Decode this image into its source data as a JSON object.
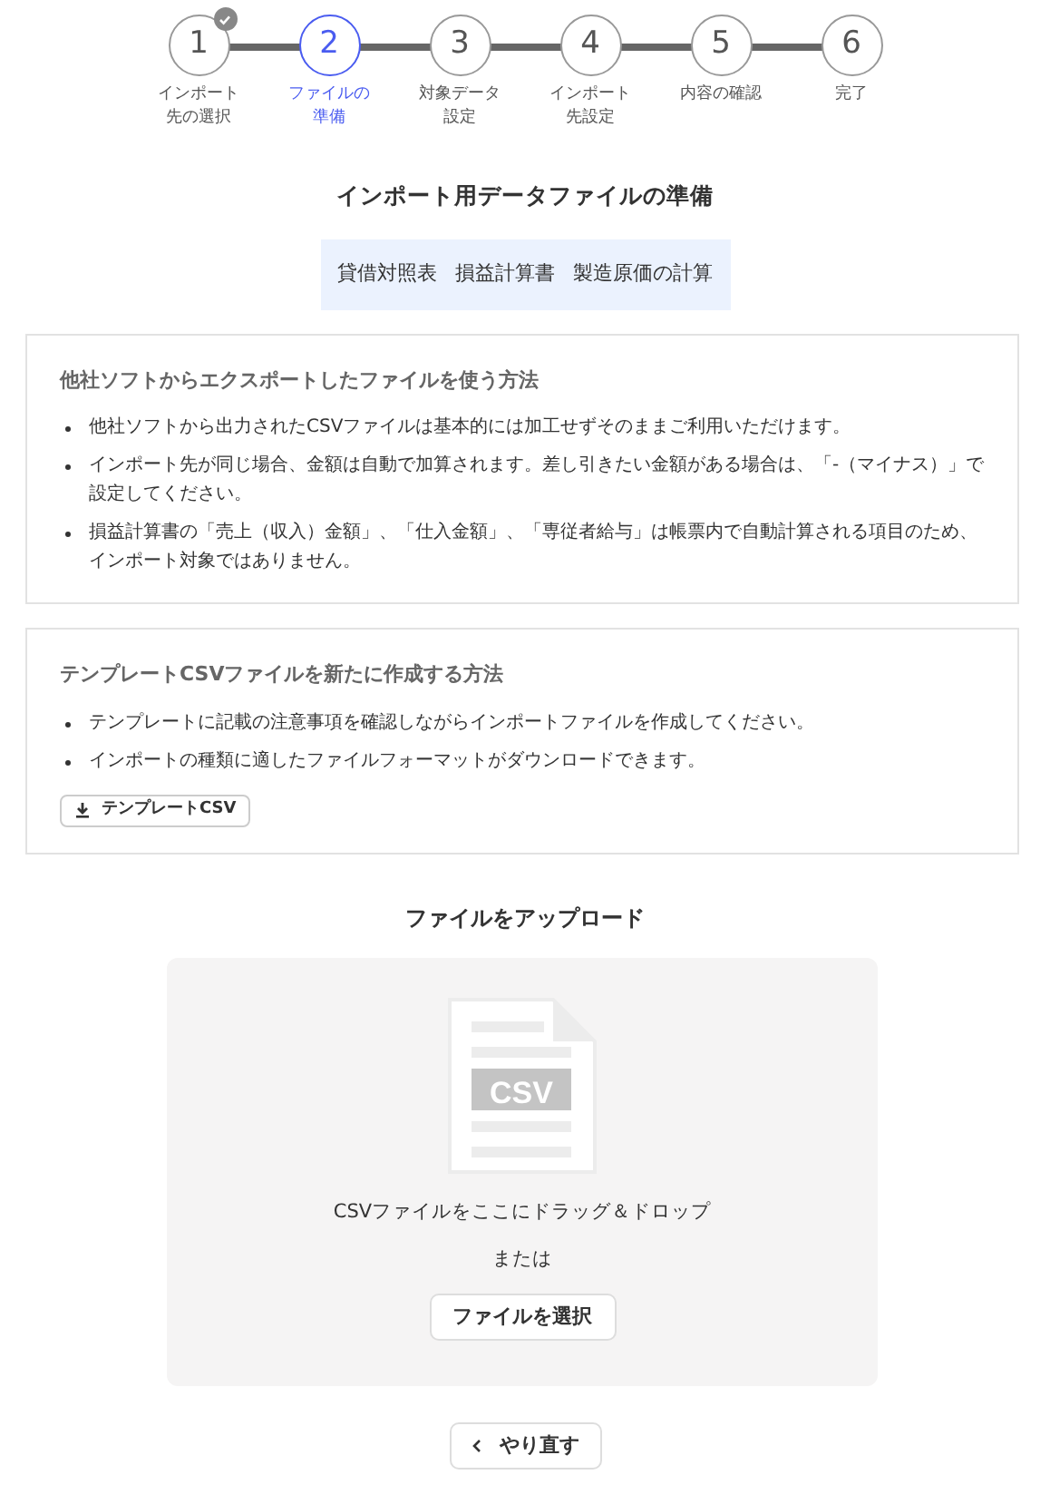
{
  "steps": [
    {
      "number": "1",
      "label_lines": [
        "インポート",
        "先の選択"
      ],
      "completed": true,
      "selected": false
    },
    {
      "number": "2",
      "label_lines": [
        "ファイルの",
        "準備"
      ],
      "completed": false,
      "selected": true
    },
    {
      "number": "3",
      "label_lines": [
        "対象データ",
        "設定"
      ],
      "completed": false,
      "selected": false
    },
    {
      "number": "4",
      "label_lines": [
        "インポート",
        "先設定"
      ],
      "completed": false,
      "selected": false
    },
    {
      "number": "5",
      "label_lines": [
        "内容の確認"
      ],
      "completed": false,
      "selected": false
    },
    {
      "number": "6",
      "label_lines": [
        "完了"
      ],
      "completed": false,
      "selected": false
    }
  ],
  "heading": "インポート用データファイルの準備",
  "targets": [
    "貸借対照表",
    "損益計算書",
    "製造原価の計算"
  ],
  "sections": [
    {
      "title": "他社ソフトからエクスポートしたファイルを使う方法",
      "bullets": [
        "他社ソフトから出力されたCSVファイルは基本的には加工せずそのままご利用いただけます。",
        "インポート先が同じ場合、金額は自動で加算されます。差し引きたい金額がある場合は、「-（マイナス）」で設定してください。",
        "損益計算書の「売上（収入）金額」、「仕入金額」、「専従者給与」は帳票内で自動計算される項目のため、インポート対象ではありません。"
      ]
    },
    {
      "title": "テンプレートCSVファイルを新たに作成する方法",
      "bullets": [
        "テンプレートに記載の注意事項を確認しながらインポートファイルを作成してください。",
        "インポートの種類に適したファイルフォーマットがダウンロードできます。"
      ],
      "button": "テンプレートCSV"
    }
  ],
  "upload": {
    "title": "ファイルをアップロード",
    "icon_label": "CSV",
    "drop_text": "CSVファイルをここにドラッグ＆ドロップ",
    "or_text": "または",
    "select_button": "ファイルを選択"
  },
  "back_button": "やり直す"
}
